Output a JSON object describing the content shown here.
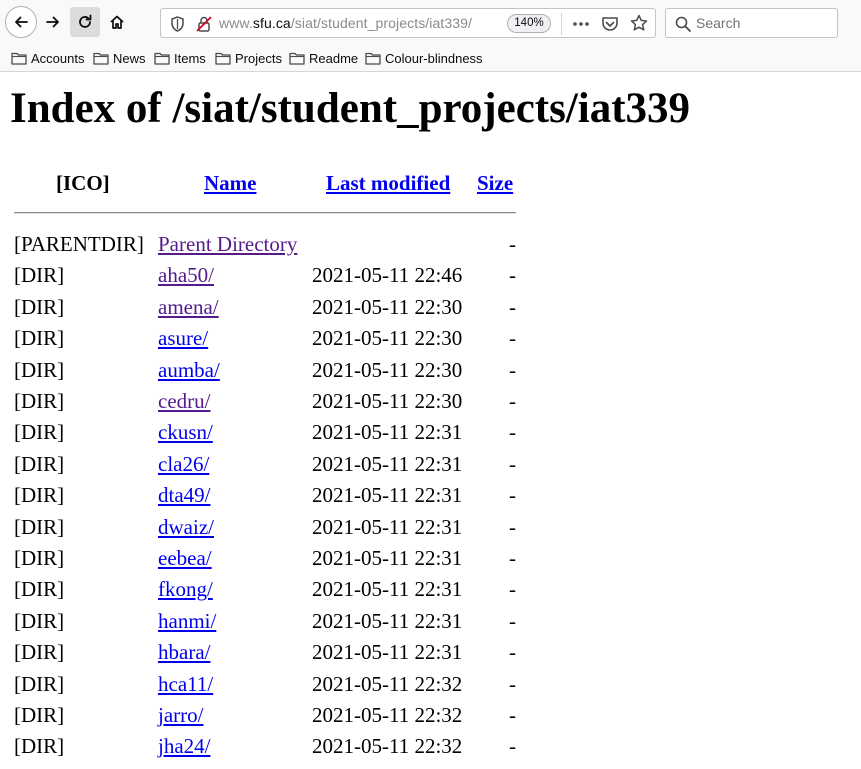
{
  "browser": {
    "url_prefix": "www.",
    "url_host": "sfu.ca",
    "url_path": "/siat/student_projects/iat339/",
    "zoom": "140%",
    "search_placeholder": "Search",
    "bookmarks": [
      "Accounts",
      "News",
      "Items",
      "Projects",
      "Readme",
      "Colour-blindness"
    ]
  },
  "page": {
    "title": "Index of /siat/student_projects/iat339",
    "headers": {
      "icon": "[ICO]",
      "name": "Name",
      "modified": "Last modified",
      "size": "Size"
    },
    "rows": [
      {
        "icon": "[PARENTDIR]",
        "name": "Parent Directory",
        "modified": "",
        "size": "-",
        "visited": true
      },
      {
        "icon": "[DIR]",
        "name": "aha50/",
        "modified": "2021-05-11 22:46",
        "size": "-",
        "visited": true
      },
      {
        "icon": "[DIR]",
        "name": "amena/",
        "modified": "2021-05-11 22:30",
        "size": "-",
        "visited": true
      },
      {
        "icon": "[DIR]",
        "name": "asure/",
        "modified": "2021-05-11 22:30",
        "size": "-",
        "visited": false
      },
      {
        "icon": "[DIR]",
        "name": "aumba/",
        "modified": "2021-05-11 22:30",
        "size": "-",
        "visited": false
      },
      {
        "icon": "[DIR]",
        "name": "cedru/",
        "modified": "2021-05-11 22:30",
        "size": "-",
        "visited": true
      },
      {
        "icon": "[DIR]",
        "name": "ckusn/",
        "modified": "2021-05-11 22:31",
        "size": "-",
        "visited": false
      },
      {
        "icon": "[DIR]",
        "name": "cla26/",
        "modified": "2021-05-11 22:31",
        "size": "-",
        "visited": false
      },
      {
        "icon": "[DIR]",
        "name": "dta49/",
        "modified": "2021-05-11 22:31",
        "size": "-",
        "visited": false
      },
      {
        "icon": "[DIR]",
        "name": "dwaiz/",
        "modified": "2021-05-11 22:31",
        "size": "-",
        "visited": false
      },
      {
        "icon": "[DIR]",
        "name": "eebea/",
        "modified": "2021-05-11 22:31",
        "size": "-",
        "visited": false
      },
      {
        "icon": "[DIR]",
        "name": "fkong/",
        "modified": "2021-05-11 22:31",
        "size": "-",
        "visited": false
      },
      {
        "icon": "[DIR]",
        "name": "hanmi/",
        "modified": "2021-05-11 22:31",
        "size": "-",
        "visited": false
      },
      {
        "icon": "[DIR]",
        "name": "hbara/",
        "modified": "2021-05-11 22:31",
        "size": "-",
        "visited": false
      },
      {
        "icon": "[DIR]",
        "name": "hca11/",
        "modified": "2021-05-11 22:32",
        "size": "-",
        "visited": false
      },
      {
        "icon": "[DIR]",
        "name": "jarro/",
        "modified": "2021-05-11 22:32",
        "size": "-",
        "visited": false
      },
      {
        "icon": "[DIR]",
        "name": "jha24/",
        "modified": "2021-05-11 22:32",
        "size": "-",
        "visited": false
      }
    ]
  },
  "colors": {
    "link": "#0000ee",
    "visited_link": "#551a8b",
    "toolbar_bg": "#f9f9fa"
  }
}
